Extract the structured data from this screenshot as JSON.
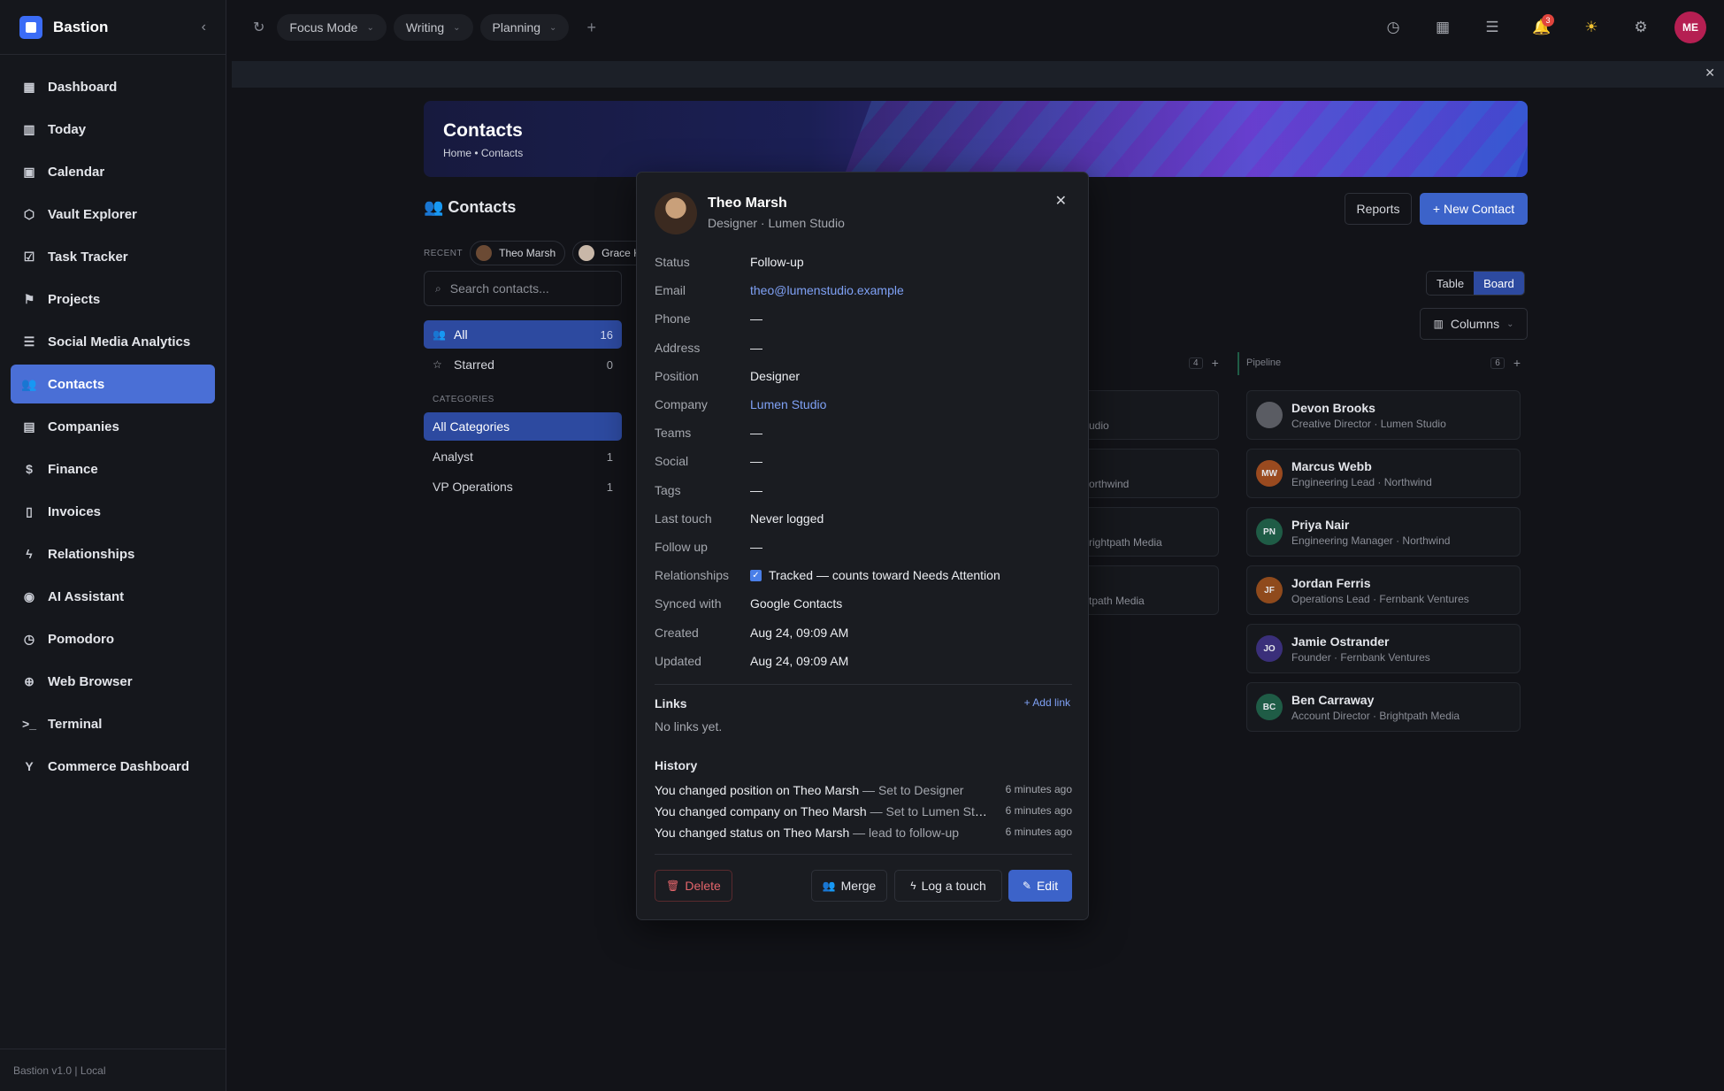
{
  "app": {
    "name": "Bastion",
    "footer": "Bastion v1.0 | Local"
  },
  "sidebar": {
    "items": [
      {
        "label": "Dashboard",
        "icon": "dashboard-icon",
        "glyph": "▦"
      },
      {
        "label": "Today",
        "icon": "columns-icon",
        "glyph": "▥"
      },
      {
        "label": "Calendar",
        "icon": "calendar-icon",
        "glyph": "▣"
      },
      {
        "label": "Vault Explorer",
        "icon": "cube-icon",
        "glyph": "⬡"
      },
      {
        "label": "Task Tracker",
        "icon": "checkbox-icon",
        "glyph": "☑"
      },
      {
        "label": "Projects",
        "icon": "projects-icon",
        "glyph": "⚑"
      },
      {
        "label": "Social Media Analytics",
        "icon": "list-icon",
        "glyph": "☰"
      },
      {
        "label": "Contacts",
        "icon": "users-icon",
        "glyph": "👥"
      },
      {
        "label": "Companies",
        "icon": "building-icon",
        "glyph": "▤"
      },
      {
        "label": "Finance",
        "icon": "dollar-icon",
        "glyph": "$"
      },
      {
        "label": "Invoices",
        "icon": "file-icon",
        "glyph": "▯"
      },
      {
        "label": "Relationships",
        "icon": "bolt-icon",
        "glyph": "ϟ"
      },
      {
        "label": "AI Assistant",
        "icon": "brain-icon",
        "glyph": "◉"
      },
      {
        "label": "Pomodoro",
        "icon": "timer-icon",
        "glyph": "◷"
      },
      {
        "label": "Web Browser",
        "icon": "globe-icon",
        "glyph": "⊕"
      },
      {
        "label": "Terminal",
        "icon": "terminal-icon",
        "glyph": ">_"
      },
      {
        "label": "Commerce Dashboard",
        "icon": "branch-icon",
        "glyph": "Y"
      }
    ],
    "active_index": 7
  },
  "topbar": {
    "tabs": [
      {
        "label": "Focus Mode"
      },
      {
        "label": "Writing"
      },
      {
        "label": "Planning"
      }
    ],
    "notification_count": "3",
    "user_initials": "ME"
  },
  "hero": {
    "title": "Contacts",
    "breadcrumb": "Home • Contacts"
  },
  "contacts": {
    "heading": "👥 Contacts",
    "recent_label": "RECENT",
    "recent": [
      "Theo Marsh",
      "Grace Kim"
    ],
    "search_placeholder": "Search contacts...",
    "filters": [
      {
        "label": "All",
        "count": "16",
        "glyph": "👥"
      },
      {
        "label": "Starred",
        "count": "0",
        "glyph": "☆"
      }
    ],
    "categories_label": "CATEGORIES",
    "categories": [
      {
        "label": "All Categories",
        "count": ""
      },
      {
        "label": "Analyst",
        "count": "1"
      },
      {
        "label": "VP Operations",
        "count": "1"
      }
    ]
  },
  "actions": {
    "reports": "Reports",
    "new_contact": "+ New Contact",
    "table": "Table",
    "board": "Board",
    "columns": "Columns"
  },
  "board": {
    "col1": {
      "count": "4",
      "peeks": [
        "udio",
        "orthwind",
        "rightpath Media",
        "tpath Media"
      ]
    },
    "pipeline": {
      "title": "Pipeline",
      "count": "6",
      "cards": [
        {
          "name": "Devon Brooks",
          "sub": "Creative Director · Lumen Studio",
          "initials": "",
          "color": "#5a5c63"
        },
        {
          "name": "Marcus Webb",
          "sub": "Engineering Lead · Northwind",
          "initials": "MW",
          "color": "#9a4a1f"
        },
        {
          "name": "Priya Nair",
          "sub": "Engineering Manager · Northwind",
          "initials": "PN",
          "color": "#1f5c46"
        },
        {
          "name": "Jordan Ferris",
          "sub": "Operations Lead · Fernbank Ventures",
          "initials": "JF",
          "color": "#8f4a1c"
        },
        {
          "name": "Jamie Ostrander",
          "sub": "Founder · Fernbank Ventures",
          "initials": "JO",
          "color": "#3a2f7a"
        },
        {
          "name": "Ben Carraway",
          "sub": "Account Director · Brightpath Media",
          "initials": "BC",
          "color": "#1f5c46"
        }
      ]
    }
  },
  "modal": {
    "name": "Theo Marsh",
    "subtitle": "Designer · Lumen Studio",
    "fields": [
      {
        "label": "Status",
        "value": "Follow-up",
        "type": "text"
      },
      {
        "label": "Email",
        "value": "theo@lumenstudio.example",
        "type": "link"
      },
      {
        "label": "Phone",
        "value": "—",
        "type": "text"
      },
      {
        "label": "Address",
        "value": "—",
        "type": "text"
      },
      {
        "label": "Position",
        "value": "Designer",
        "type": "text"
      },
      {
        "label": "Company",
        "value": "Lumen Studio",
        "type": "link"
      },
      {
        "label": "Teams",
        "value": "—",
        "type": "text"
      },
      {
        "label": "Social",
        "value": "—",
        "type": "text"
      },
      {
        "label": "Tags",
        "value": "—",
        "type": "text"
      },
      {
        "label": "Last touch",
        "value": "Never logged",
        "type": "text"
      },
      {
        "label": "Follow up",
        "value": "—",
        "type": "text"
      },
      {
        "label": "Relationships",
        "value": "Tracked — counts toward Needs Attention",
        "type": "check"
      },
      {
        "label": "Synced with",
        "value": "Google Contacts",
        "type": "text"
      },
      {
        "label": "Created",
        "value": "Aug 24, 09:09 AM",
        "type": "text"
      },
      {
        "label": "Updated",
        "value": "Aug 24, 09:09 AM",
        "type": "text"
      }
    ],
    "links_title": "Links",
    "add_link": "+ Add link",
    "no_links": "No links yet.",
    "history_title": "History",
    "history": [
      {
        "main": "You changed position on Theo Marsh",
        "detail": " — Set to Designer",
        "time": "6 minutes ago"
      },
      {
        "main": "You changed company on Theo Marsh",
        "detail": " — Set to Lumen Studio",
        "time": "6 minutes ago"
      },
      {
        "main": "You changed status on Theo Marsh",
        "detail": " — lead to follow-up",
        "time": "6 minutes ago"
      }
    ],
    "buttons": {
      "delete": "Delete",
      "merge": "Merge",
      "log": "Log a touch",
      "edit": "Edit"
    }
  }
}
